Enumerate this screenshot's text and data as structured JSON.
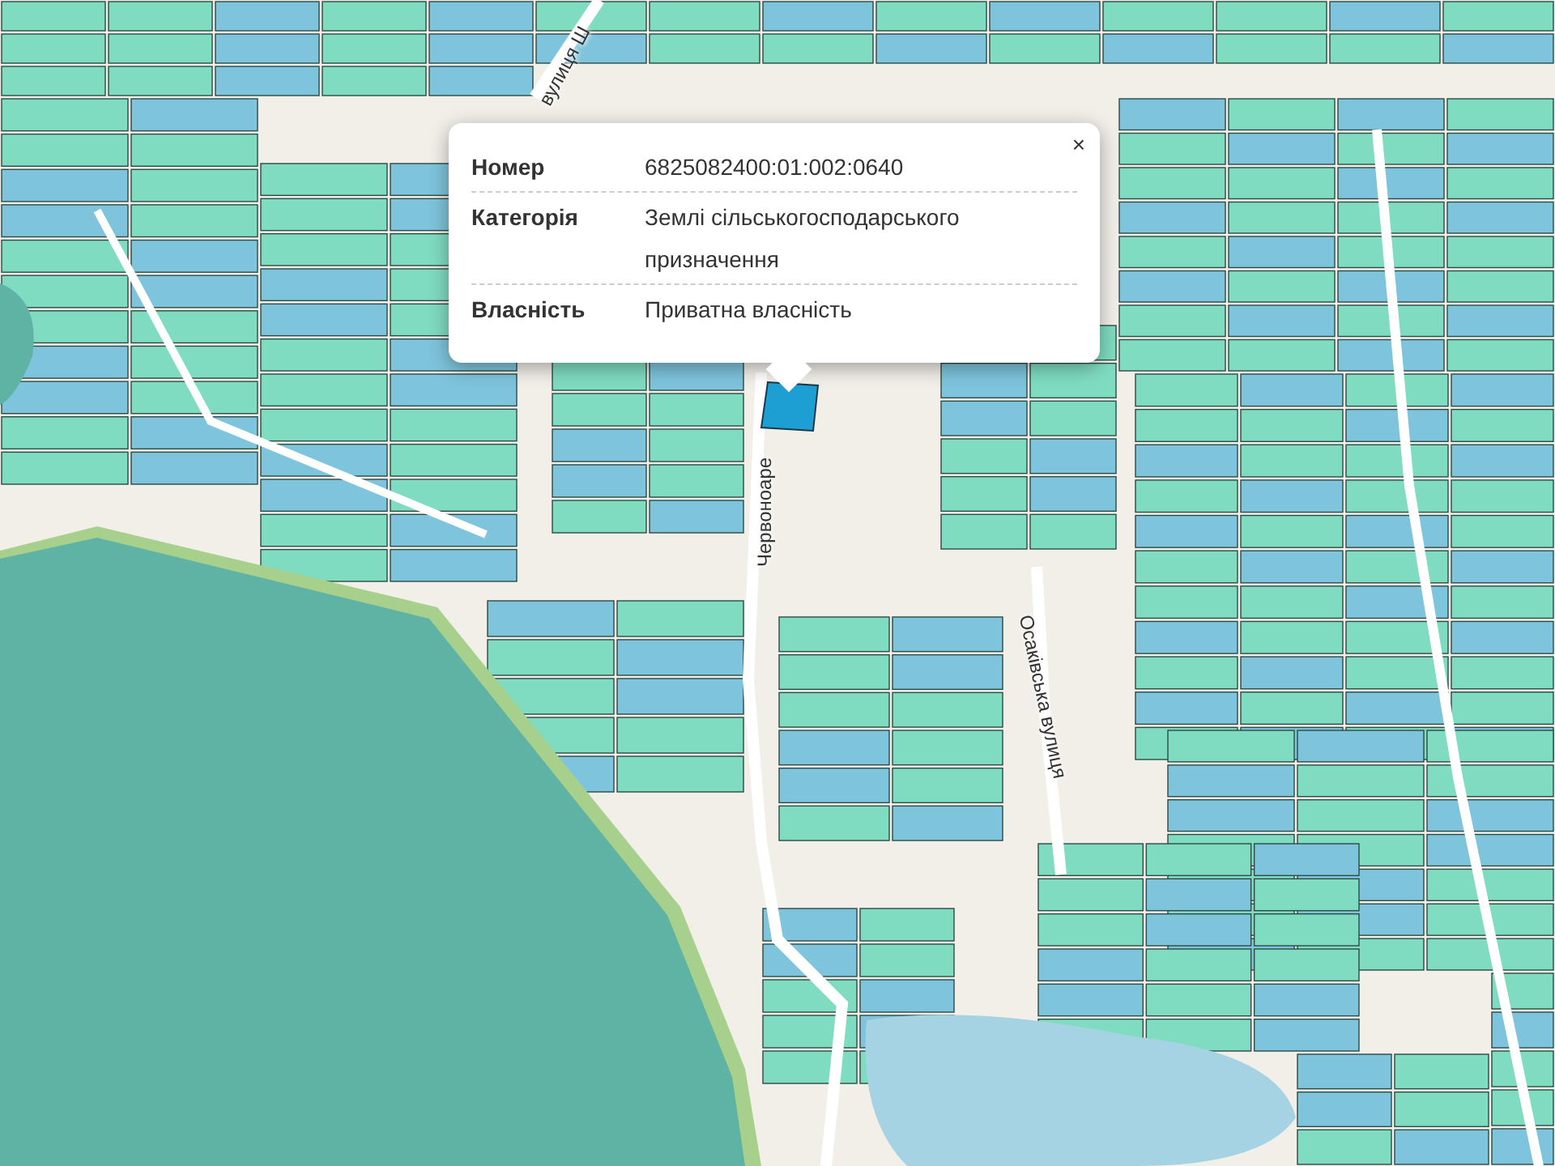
{
  "popup": {
    "close": "×",
    "rows": [
      {
        "label": "Номер",
        "value": "6825082400:01:002:0640"
      },
      {
        "label": "Категорія",
        "value": "Землі сільськогосподарського призначення"
      },
      {
        "label": "Власність",
        "value": "Приватна власність"
      }
    ]
  },
  "street_labels": [
    {
      "text": "вулиця Ш"
    },
    {
      "text": "Червоноаре"
    },
    {
      "text": "Осаківська вулиця"
    }
  ]
}
